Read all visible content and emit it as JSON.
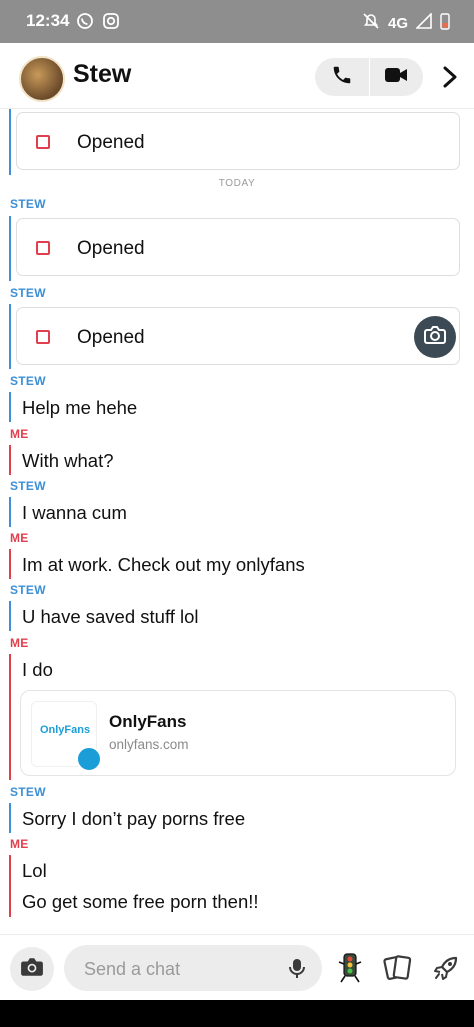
{
  "status": {
    "time": "12:34",
    "network": "4G"
  },
  "header": {
    "name": "Stew"
  },
  "chat": {
    "opened_label": "Opened",
    "today_label": "TODAY",
    "stew_label": "STEW",
    "me_label": "ME",
    "messages": {
      "m1": "Help me hehe",
      "m2": "With what?",
      "m3": "I wanna cum",
      "m4": "Im at work. Check out my onlyfans",
      "m5": "U have saved stuff lol",
      "m6": "I do",
      "m7": "Sorry I don’t pay porns free",
      "m8": "Lol",
      "m9": "Go get some free porn then!!"
    },
    "link": {
      "thumb_text": "OnlyFans",
      "title": "OnlyFans",
      "url": "onlyfans.com"
    }
  },
  "composer": {
    "placeholder": "Send a chat"
  },
  "colors": {
    "stew": "#3d8fd6",
    "me": "#e0404d"
  },
  "icons": [
    "whatsapp-icon",
    "instagram-icon",
    "notifications-off-icon",
    "signal-icon",
    "battery-icon",
    "phone-icon",
    "video-icon",
    "chevron-right-icon",
    "camera-icon",
    "mic-icon",
    "bitmoji-icon",
    "cards-icon",
    "rocket-icon",
    "onlyfans-logo-icon"
  ]
}
